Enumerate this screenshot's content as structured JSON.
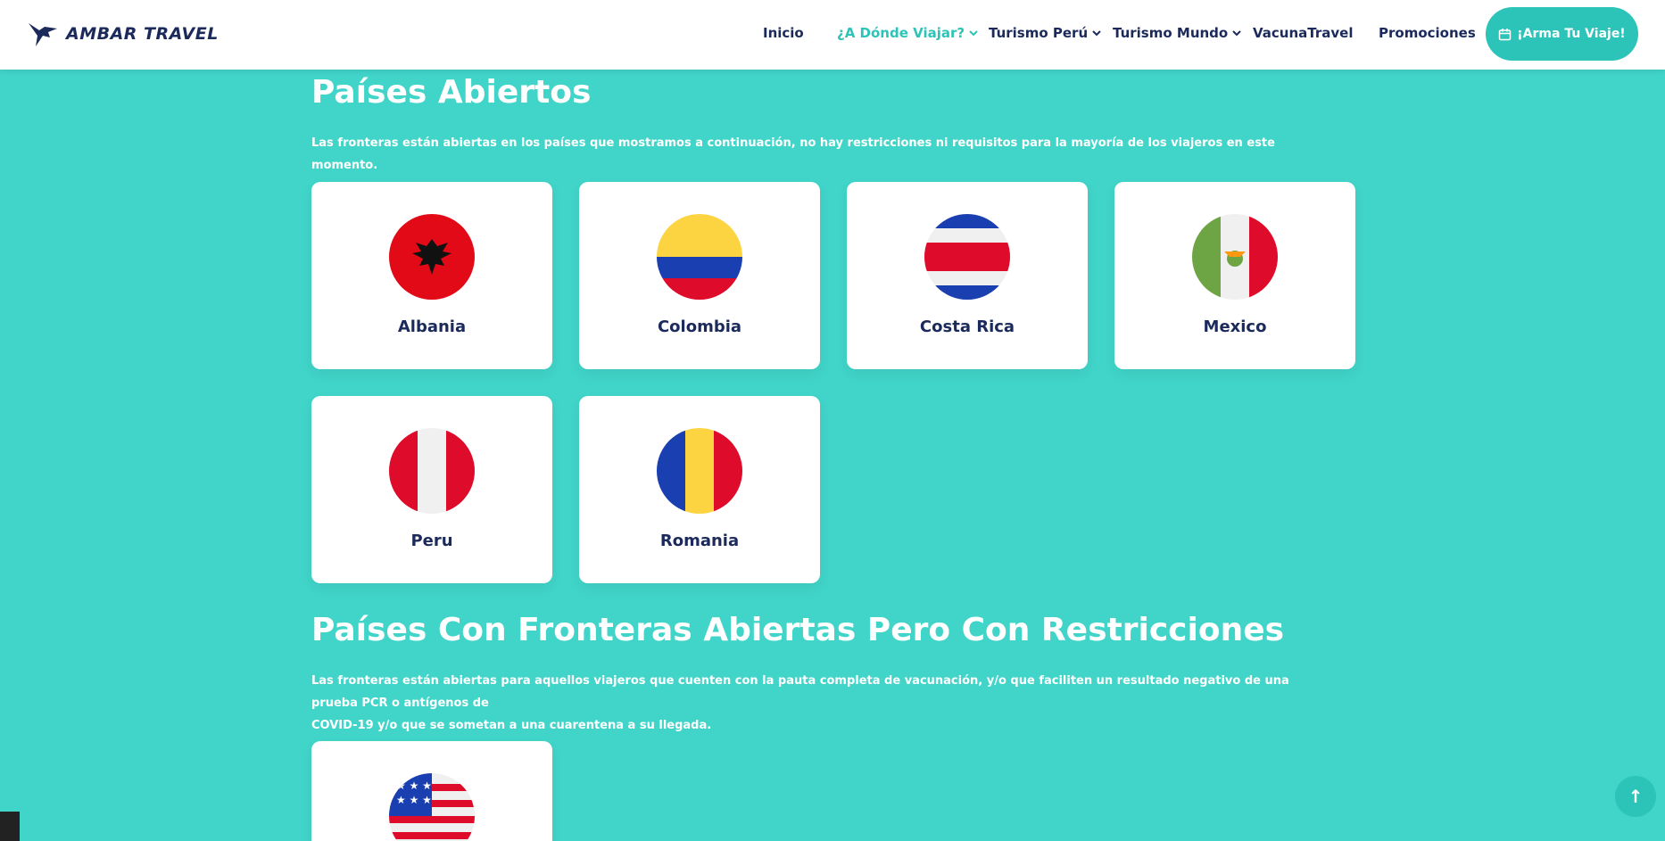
{
  "brand": {
    "name": "AMBAR TRAVEL",
    "color": "#1b2a5a",
    "accent": "#2cc4b8",
    "background": "#41d4c9"
  },
  "nav": {
    "items": [
      {
        "label": "Inicio",
        "dropdown": false,
        "active": false
      },
      {
        "label": "¿A Dónde Viajar?",
        "dropdown": true,
        "active": true
      },
      {
        "label": "Turismo Perú",
        "dropdown": true,
        "active": false
      },
      {
        "label": "Turismo Mundo",
        "dropdown": true,
        "active": false
      },
      {
        "label": "VacunaTravel",
        "dropdown": false,
        "active": false
      },
      {
        "label": "Promociones",
        "dropdown": false,
        "active": false
      }
    ],
    "cta_label": "¡Arma Tu Viaje!",
    "cta_icon": "calendar-icon"
  },
  "open_section": {
    "title": "Países Abiertos",
    "description": "Las fronteras están abiertas en los países que mostramos a continuación, no hay restricciones ni requisitos para la mayoría de los viajeros en este momento.",
    "countries": [
      {
        "name": "Albania",
        "flag": "albania-flag-icon"
      },
      {
        "name": "Colombia",
        "flag": "colombia-flag-icon"
      },
      {
        "name": "Costa Rica",
        "flag": "costa-rica-flag-icon"
      },
      {
        "name": "Mexico",
        "flag": "mexico-flag-icon"
      },
      {
        "name": "Peru",
        "flag": "peru-flag-icon"
      },
      {
        "name": "Romania",
        "flag": "romania-flag-icon"
      }
    ]
  },
  "restricted_section": {
    "title": "Países Con Fronteras Abiertas Pero Con Restricciones",
    "description_line1": "Las fronteras están abiertas para aquellos viajeros que cuenten con la pauta completa de vacunación, y/o que faciliten un resultado negativo de una prueba PCR o antígenos de",
    "description_line2": "COVID-19 y/o que se sometan a una cuarentena a su llegada.",
    "countries": [
      {
        "name": "",
        "flag": "usa-flag-icon"
      }
    ]
  },
  "scroll_top_icon": "arrow-up-icon"
}
